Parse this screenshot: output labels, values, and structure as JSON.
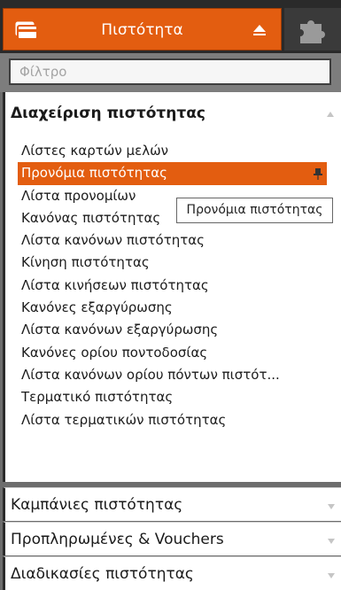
{
  "header": {
    "title": "Πιστότητα",
    "card_icon": "loyalty-card-icon",
    "collapse_icon": "caret-up-icon",
    "side_icon": "puzzle-piece-icon",
    "accent_color": "#e35d10"
  },
  "filter": {
    "placeholder": "Φίλτρο",
    "value": ""
  },
  "open_section": {
    "title": "Διαχείριση πιστότητας",
    "items": [
      {
        "label": "Λίστες καρτών μελών"
      },
      {
        "label": "Προνόμια πιστότητας",
        "active": true,
        "icon": "pin-icon"
      },
      {
        "label": "Λίστα προνομίων"
      },
      {
        "label": "Κανόνας πιστότητας"
      },
      {
        "label": "Λίστα κανόνων πιστότητας"
      },
      {
        "label": "Κίνηση πιστότητας"
      },
      {
        "label": "Λίστα κινήσεων πιστότητας"
      },
      {
        "label": "Κανόνες εξαργύρωσης"
      },
      {
        "label": "Λίστα κανόνων εξαργύρωσης"
      },
      {
        "label": "Κανόνες ορίου ποντοδοσίας"
      },
      {
        "label": "Λίστα κανόνων ορίου πόντων πιστότ..."
      },
      {
        "label": "Τερματικό πιστότητας"
      },
      {
        "label": "Λίστα τερματικών πιστότητας"
      }
    ]
  },
  "tooltip": {
    "text": "Προνόμια πιστότητας"
  },
  "collapsed_sections": [
    {
      "label": "Καμπάνιες πιστότητας"
    },
    {
      "label": "Προπληρωμένες & Vouchers"
    },
    {
      "label": "Διαδικασίες πιστότητας"
    }
  ]
}
